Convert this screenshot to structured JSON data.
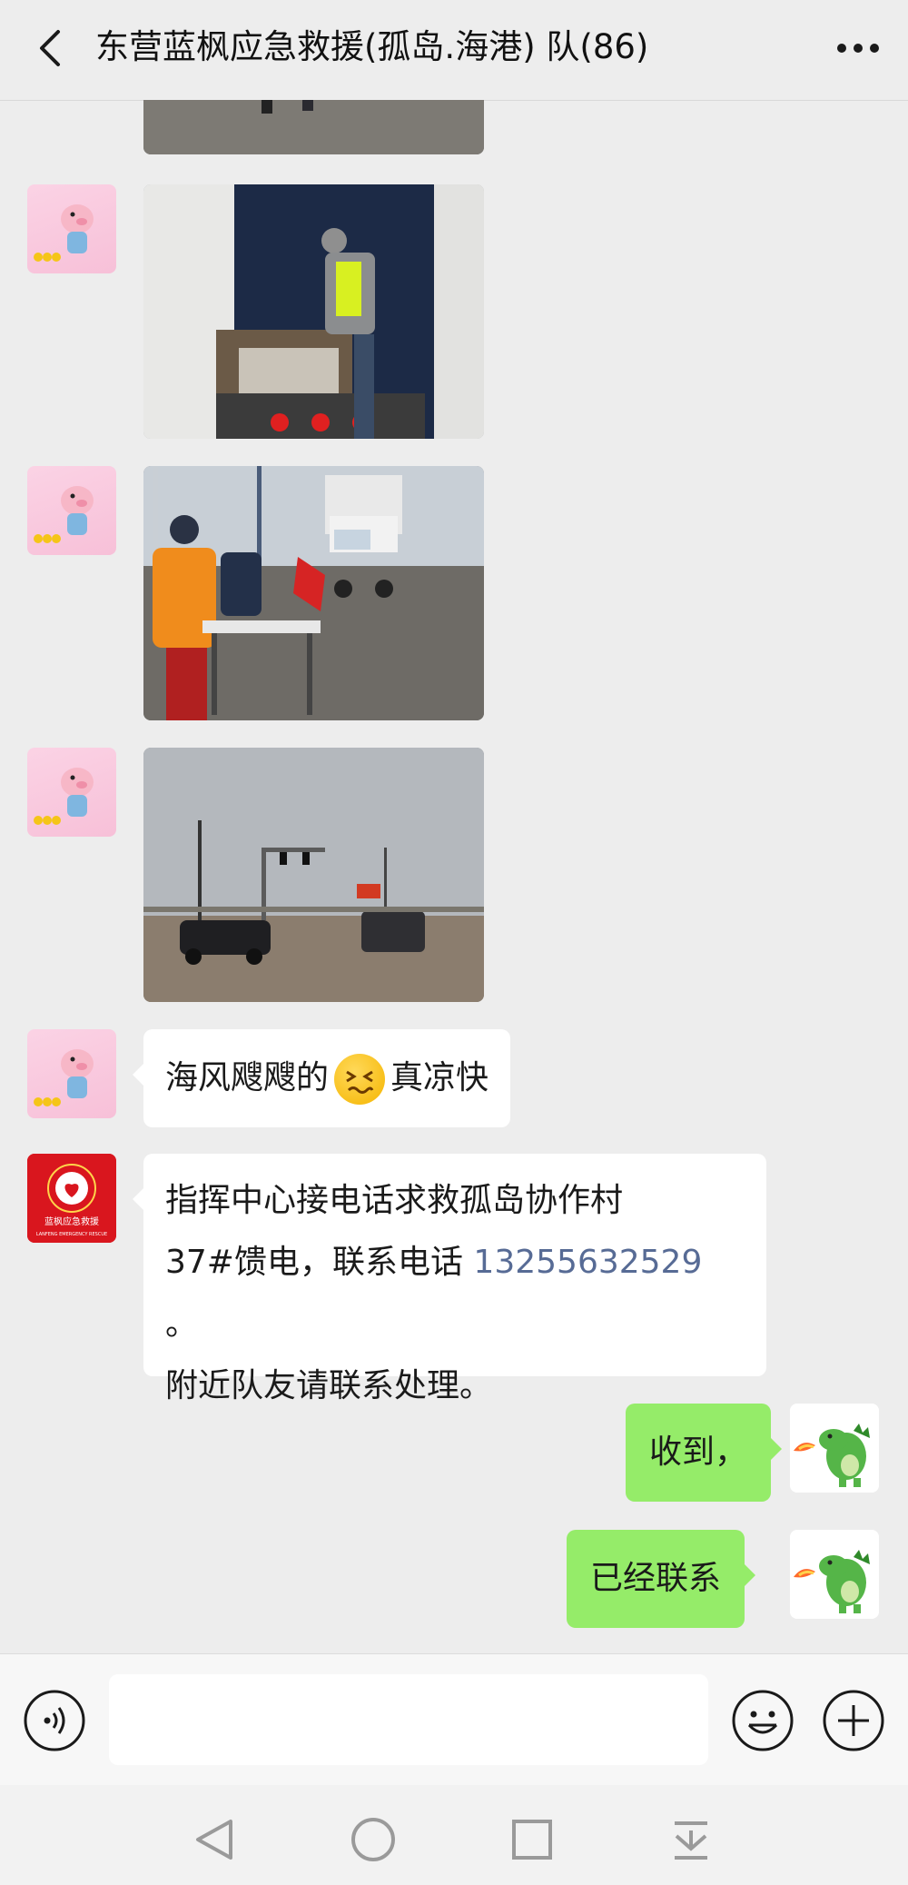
{
  "header": {
    "title": "东营蓝枫应急救援(孤岛.海港) 队(86)"
  },
  "icons": {
    "back": "chevron-left-icon",
    "more": "more-dots-icon",
    "voice": "voice-icon",
    "emoji": "emoji-icon",
    "plus": "plus-icon"
  },
  "logo_avatar": {
    "name": "蓝枫应急救援",
    "subtext": "LANFENG EMERGENCY RESCUE"
  },
  "messages": [
    {
      "type": "image",
      "sender": "other",
      "avatar": "pig-avatar",
      "content": "truck-loading-photo"
    },
    {
      "type": "image",
      "sender": "other",
      "avatar": "pig-avatar",
      "content": "checkpoint-photo"
    },
    {
      "type": "image",
      "sender": "other",
      "avatar": "pig-avatar",
      "content": "road-intersection-photo"
    },
    {
      "type": "text",
      "sender": "other",
      "avatar": "pig-avatar",
      "text_before": "海风飕飕的",
      "emoji": "grimacing-face",
      "text_after": "真凉快"
    },
    {
      "type": "text",
      "sender": "other",
      "avatar": "logo-avatar",
      "line1": "指挥中心接电话求救孤岛协作村",
      "line2_prefix": "37#馈电，联系电话 ",
      "phone": "13255632529",
      "line2_suffix": " 。",
      "line3": "附近队友请联系处理。"
    },
    {
      "type": "text",
      "sender": "me",
      "avatar": "dino-avatar",
      "text": "收到，"
    },
    {
      "type": "text",
      "sender": "me",
      "avatar": "dino-avatar",
      "text": "已经联系"
    }
  ],
  "input": {
    "value": "",
    "placeholder": ""
  },
  "colors": {
    "background": "#ededed",
    "my_bubble": "#95ec69",
    "other_bubble": "#ffffff",
    "link": "#576b95",
    "logo_red": "#d9161e"
  }
}
